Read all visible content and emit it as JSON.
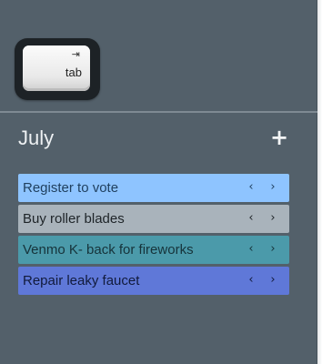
{
  "keycap": {
    "arrow": "⇥",
    "label": "tab"
  },
  "month": {
    "title": "July",
    "add_label": "+"
  },
  "tasks": [
    {
      "label": "Register to vote",
      "bg": "#8ec4ff",
      "fg": "#1f3f5e"
    },
    {
      "label": "Buy roller blades",
      "bg": "#a9b3bb",
      "fg": "#1e2428"
    },
    {
      "label": "Venmo K- back for fireworks",
      "bg": "#4b9aaa",
      "fg": "#16333a"
    },
    {
      "label": "Repair leaky faucet",
      "bg": "#5f78d8",
      "fg": "#111a3b"
    }
  ],
  "nav": {
    "prev": "‹",
    "next": "›"
  }
}
